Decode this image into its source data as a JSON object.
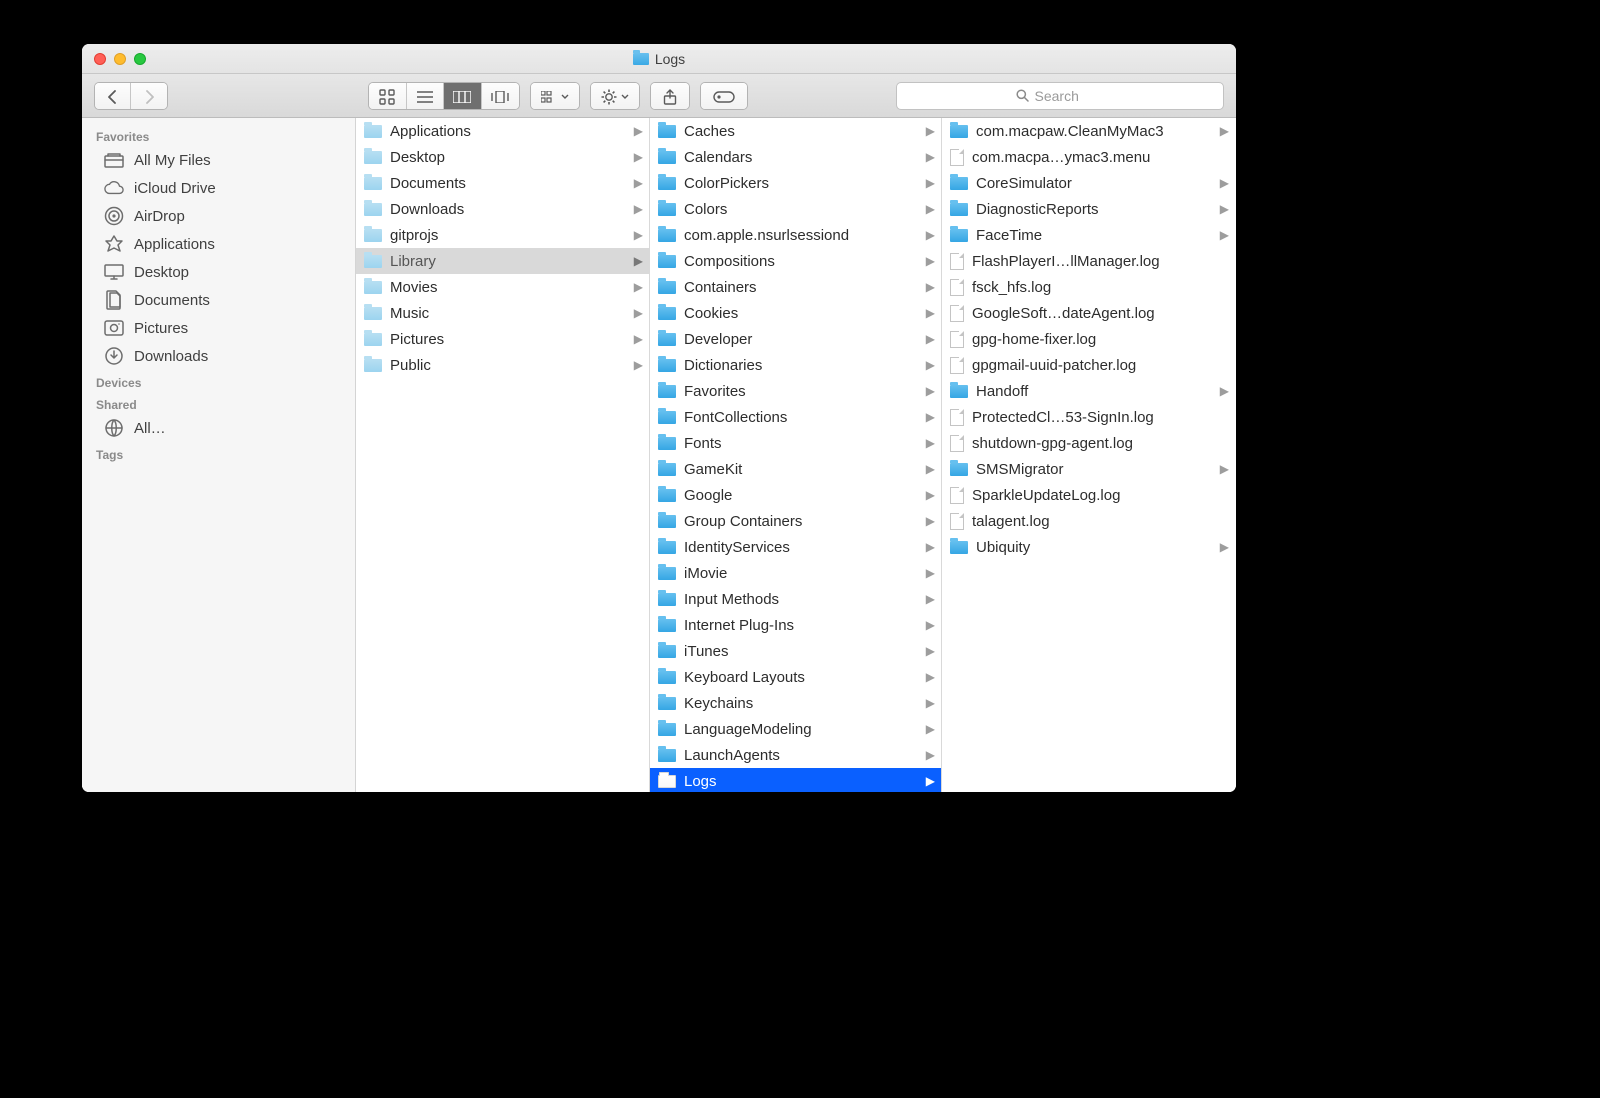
{
  "window": {
    "title": "Logs"
  },
  "search": {
    "placeholder": "Search"
  },
  "sidebar": {
    "sections": [
      {
        "label": "Favorites",
        "items": [
          {
            "icon": "all-my-files",
            "label": "All My Files"
          },
          {
            "icon": "icloud",
            "label": "iCloud Drive"
          },
          {
            "icon": "airdrop",
            "label": "AirDrop"
          },
          {
            "icon": "applications",
            "label": "Applications"
          },
          {
            "icon": "desktop",
            "label": "Desktop"
          },
          {
            "icon": "documents",
            "label": "Documents"
          },
          {
            "icon": "pictures",
            "label": "Pictures"
          },
          {
            "icon": "downloads",
            "label": "Downloads"
          }
        ]
      },
      {
        "label": "Devices",
        "items": []
      },
      {
        "label": "Shared",
        "items": [
          {
            "icon": "network",
            "label": "All…"
          }
        ]
      },
      {
        "label": "Tags",
        "items": []
      }
    ]
  },
  "columns": [
    [
      {
        "label": "Applications",
        "type": "folder-lite",
        "hasChildren": true
      },
      {
        "label": "Desktop",
        "type": "folder-lite",
        "hasChildren": true
      },
      {
        "label": "Documents",
        "type": "folder-lite",
        "hasChildren": true
      },
      {
        "label": "Downloads",
        "type": "folder-lite",
        "hasChildren": true
      },
      {
        "label": "gitprojs",
        "type": "folder-lite",
        "hasChildren": true
      },
      {
        "label": "Library",
        "type": "folder-lite",
        "hasChildren": true,
        "selected": "parent"
      },
      {
        "label": "Movies",
        "type": "folder-lite",
        "hasChildren": true
      },
      {
        "label": "Music",
        "type": "folder-lite",
        "hasChildren": true
      },
      {
        "label": "Pictures",
        "type": "folder-lite",
        "hasChildren": true
      },
      {
        "label": "Public",
        "type": "folder-lite",
        "hasChildren": true
      }
    ],
    [
      {
        "label": "Caches",
        "type": "folder-blue",
        "hasChildren": true
      },
      {
        "label": "Calendars",
        "type": "folder-blue",
        "hasChildren": true
      },
      {
        "label": "ColorPickers",
        "type": "folder-blue",
        "hasChildren": true
      },
      {
        "label": "Colors",
        "type": "folder-blue",
        "hasChildren": true
      },
      {
        "label": "com.apple.nsurlsessiond",
        "type": "folder-blue",
        "hasChildren": true
      },
      {
        "label": "Compositions",
        "type": "folder-blue",
        "hasChildren": true
      },
      {
        "label": "Containers",
        "type": "folder-blue",
        "hasChildren": true
      },
      {
        "label": "Cookies",
        "type": "folder-blue",
        "hasChildren": true
      },
      {
        "label": "Developer",
        "type": "folder-blue",
        "hasChildren": true
      },
      {
        "label": "Dictionaries",
        "type": "folder-blue",
        "hasChildren": true
      },
      {
        "label": "Favorites",
        "type": "folder-blue",
        "hasChildren": true
      },
      {
        "label": "FontCollections",
        "type": "folder-blue",
        "hasChildren": true
      },
      {
        "label": "Fonts",
        "type": "folder-blue",
        "hasChildren": true
      },
      {
        "label": "GameKit",
        "type": "folder-blue",
        "hasChildren": true
      },
      {
        "label": "Google",
        "type": "folder-blue",
        "hasChildren": true
      },
      {
        "label": "Group Containers",
        "type": "folder-blue",
        "hasChildren": true
      },
      {
        "label": "IdentityServices",
        "type": "folder-blue",
        "hasChildren": true
      },
      {
        "label": "iMovie",
        "type": "folder-blue",
        "hasChildren": true
      },
      {
        "label": "Input Methods",
        "type": "folder-blue",
        "hasChildren": true
      },
      {
        "label": "Internet Plug-Ins",
        "type": "folder-blue",
        "hasChildren": true
      },
      {
        "label": "iTunes",
        "type": "folder-blue",
        "hasChildren": true
      },
      {
        "label": "Keyboard Layouts",
        "type": "folder-blue",
        "hasChildren": true
      },
      {
        "label": "Keychains",
        "type": "folder-blue",
        "hasChildren": true
      },
      {
        "label": "LanguageModeling",
        "type": "folder-blue",
        "hasChildren": true
      },
      {
        "label": "LaunchAgents",
        "type": "folder-blue",
        "hasChildren": true
      },
      {
        "label": "Logs",
        "type": "folder-white",
        "hasChildren": true,
        "selected": "active"
      }
    ],
    [
      {
        "label": "com.macpaw.CleanMyMac3",
        "type": "folder-blue",
        "hasChildren": true
      },
      {
        "label": "com.macpa…ymac3.menu",
        "type": "file"
      },
      {
        "label": "CoreSimulator",
        "type": "folder-blue",
        "hasChildren": true
      },
      {
        "label": "DiagnosticReports",
        "type": "folder-blue",
        "hasChildren": true
      },
      {
        "label": "FaceTime",
        "type": "folder-blue",
        "hasChildren": true
      },
      {
        "label": "FlashPlayerI…llManager.log",
        "type": "file"
      },
      {
        "label": "fsck_hfs.log",
        "type": "file"
      },
      {
        "label": "GoogleSoft…dateAgent.log",
        "type": "file"
      },
      {
        "label": "gpg-home-fixer.log",
        "type": "file"
      },
      {
        "label": "gpgmail-uuid-patcher.log",
        "type": "file"
      },
      {
        "label": "Handoff",
        "type": "folder-blue",
        "hasChildren": true
      },
      {
        "label": "ProtectedCl…53-SignIn.log",
        "type": "file"
      },
      {
        "label": "shutdown-gpg-agent.log",
        "type": "file"
      },
      {
        "label": "SMSMigrator",
        "type": "folder-blue",
        "hasChildren": true
      },
      {
        "label": "SparkleUpdateLog.log",
        "type": "file"
      },
      {
        "label": "talagent.log",
        "type": "file"
      },
      {
        "label": "Ubiquity",
        "type": "folder-blue",
        "hasChildren": true
      }
    ]
  ]
}
